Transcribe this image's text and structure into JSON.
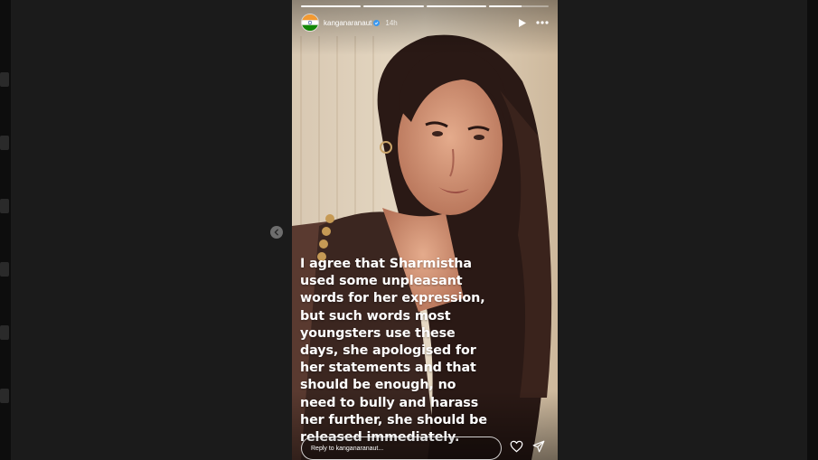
{
  "story": {
    "username": "kanganaranaut",
    "time": "14h",
    "progress": [
      1,
      1,
      1,
      0.55
    ],
    "caption": "I agree that Sharmistha used some unpleasant words for her expression, but such words most youngsters use these days, she apologised for her statements and that should be enough, no need to bully and harass her further, she should be released immediately.",
    "reply_placeholder": "Reply to kanganaranaut..."
  },
  "icons": {
    "avatar": "india-flag-icon",
    "verified": "verified-badge-icon",
    "play": "play-icon",
    "more": "more-options-icon",
    "prev": "chevron-left-icon",
    "like": "heart-icon",
    "share": "send-icon"
  },
  "colors": {
    "background": "#1b1b1b",
    "text": "#ffffff"
  }
}
